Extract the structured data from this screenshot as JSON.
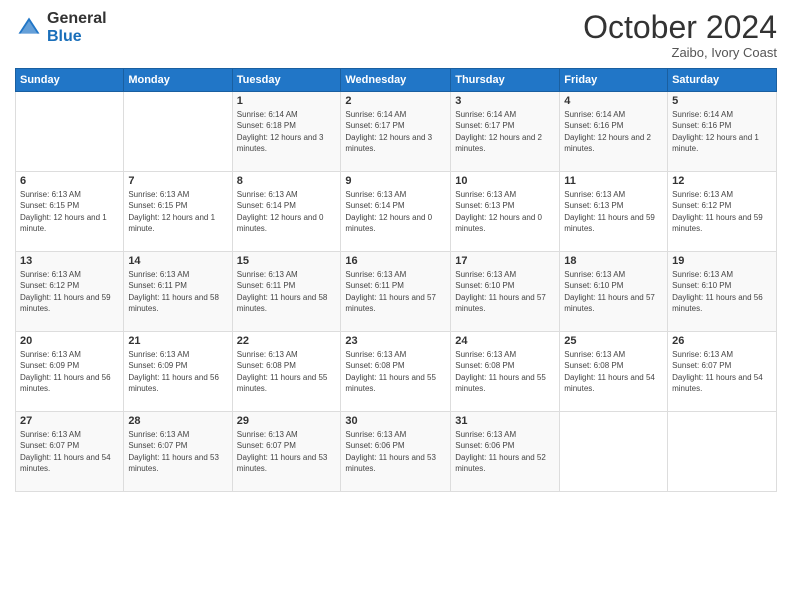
{
  "logo": {
    "general": "General",
    "blue": "Blue"
  },
  "header": {
    "month": "October 2024",
    "location": "Zaibo, Ivory Coast"
  },
  "weekdays": [
    "Sunday",
    "Monday",
    "Tuesday",
    "Wednesday",
    "Thursday",
    "Friday",
    "Saturday"
  ],
  "weeks": [
    [
      {
        "day": "",
        "info": ""
      },
      {
        "day": "",
        "info": ""
      },
      {
        "day": "1",
        "info": "Sunrise: 6:14 AM\nSunset: 6:18 PM\nDaylight: 12 hours and 3 minutes."
      },
      {
        "day": "2",
        "info": "Sunrise: 6:14 AM\nSunset: 6:17 PM\nDaylight: 12 hours and 3 minutes."
      },
      {
        "day": "3",
        "info": "Sunrise: 6:14 AM\nSunset: 6:17 PM\nDaylight: 12 hours and 2 minutes."
      },
      {
        "day": "4",
        "info": "Sunrise: 6:14 AM\nSunset: 6:16 PM\nDaylight: 12 hours and 2 minutes."
      },
      {
        "day": "5",
        "info": "Sunrise: 6:14 AM\nSunset: 6:16 PM\nDaylight: 12 hours and 1 minute."
      }
    ],
    [
      {
        "day": "6",
        "info": "Sunrise: 6:13 AM\nSunset: 6:15 PM\nDaylight: 12 hours and 1 minute."
      },
      {
        "day": "7",
        "info": "Sunrise: 6:13 AM\nSunset: 6:15 PM\nDaylight: 12 hours and 1 minute."
      },
      {
        "day": "8",
        "info": "Sunrise: 6:13 AM\nSunset: 6:14 PM\nDaylight: 12 hours and 0 minutes."
      },
      {
        "day": "9",
        "info": "Sunrise: 6:13 AM\nSunset: 6:14 PM\nDaylight: 12 hours and 0 minutes."
      },
      {
        "day": "10",
        "info": "Sunrise: 6:13 AM\nSunset: 6:13 PM\nDaylight: 12 hours and 0 minutes."
      },
      {
        "day": "11",
        "info": "Sunrise: 6:13 AM\nSunset: 6:13 PM\nDaylight: 11 hours and 59 minutes."
      },
      {
        "day": "12",
        "info": "Sunrise: 6:13 AM\nSunset: 6:12 PM\nDaylight: 11 hours and 59 minutes."
      }
    ],
    [
      {
        "day": "13",
        "info": "Sunrise: 6:13 AM\nSunset: 6:12 PM\nDaylight: 11 hours and 59 minutes."
      },
      {
        "day": "14",
        "info": "Sunrise: 6:13 AM\nSunset: 6:11 PM\nDaylight: 11 hours and 58 minutes."
      },
      {
        "day": "15",
        "info": "Sunrise: 6:13 AM\nSunset: 6:11 PM\nDaylight: 11 hours and 58 minutes."
      },
      {
        "day": "16",
        "info": "Sunrise: 6:13 AM\nSunset: 6:11 PM\nDaylight: 11 hours and 57 minutes."
      },
      {
        "day": "17",
        "info": "Sunrise: 6:13 AM\nSunset: 6:10 PM\nDaylight: 11 hours and 57 minutes."
      },
      {
        "day": "18",
        "info": "Sunrise: 6:13 AM\nSunset: 6:10 PM\nDaylight: 11 hours and 57 minutes."
      },
      {
        "day": "19",
        "info": "Sunrise: 6:13 AM\nSunset: 6:10 PM\nDaylight: 11 hours and 56 minutes."
      }
    ],
    [
      {
        "day": "20",
        "info": "Sunrise: 6:13 AM\nSunset: 6:09 PM\nDaylight: 11 hours and 56 minutes."
      },
      {
        "day": "21",
        "info": "Sunrise: 6:13 AM\nSunset: 6:09 PM\nDaylight: 11 hours and 56 minutes."
      },
      {
        "day": "22",
        "info": "Sunrise: 6:13 AM\nSunset: 6:08 PM\nDaylight: 11 hours and 55 minutes."
      },
      {
        "day": "23",
        "info": "Sunrise: 6:13 AM\nSunset: 6:08 PM\nDaylight: 11 hours and 55 minutes."
      },
      {
        "day": "24",
        "info": "Sunrise: 6:13 AM\nSunset: 6:08 PM\nDaylight: 11 hours and 55 minutes."
      },
      {
        "day": "25",
        "info": "Sunrise: 6:13 AM\nSunset: 6:08 PM\nDaylight: 11 hours and 54 minutes."
      },
      {
        "day": "26",
        "info": "Sunrise: 6:13 AM\nSunset: 6:07 PM\nDaylight: 11 hours and 54 minutes."
      }
    ],
    [
      {
        "day": "27",
        "info": "Sunrise: 6:13 AM\nSunset: 6:07 PM\nDaylight: 11 hours and 54 minutes."
      },
      {
        "day": "28",
        "info": "Sunrise: 6:13 AM\nSunset: 6:07 PM\nDaylight: 11 hours and 53 minutes."
      },
      {
        "day": "29",
        "info": "Sunrise: 6:13 AM\nSunset: 6:07 PM\nDaylight: 11 hours and 53 minutes."
      },
      {
        "day": "30",
        "info": "Sunrise: 6:13 AM\nSunset: 6:06 PM\nDaylight: 11 hours and 53 minutes."
      },
      {
        "day": "31",
        "info": "Sunrise: 6:13 AM\nSunset: 6:06 PM\nDaylight: 11 hours and 52 minutes."
      },
      {
        "day": "",
        "info": ""
      },
      {
        "day": "",
        "info": ""
      }
    ]
  ]
}
